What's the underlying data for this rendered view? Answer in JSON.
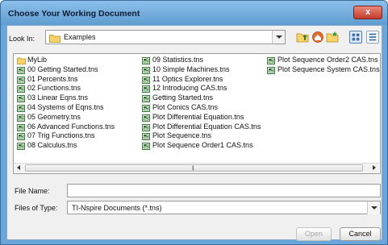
{
  "dialog": {
    "title": "Choose Your Working Document",
    "close_label": "x"
  },
  "look_in": {
    "label": "Look In:",
    "value": "Examples"
  },
  "toolbar": {
    "icons": [
      "up-folder-icon",
      "home-icon",
      "new-folder-icon",
      "list-view-icon",
      "details-view-icon"
    ]
  },
  "files": {
    "column1": [
      {
        "name": "MyLib",
        "type": "folder"
      },
      {
        "name": "00 Getting Started.tns",
        "type": "doc"
      },
      {
        "name": "01 Percents.tns",
        "type": "doc"
      },
      {
        "name": "02 Functions.tns",
        "type": "doc"
      },
      {
        "name": "03 Linear Eqns.tns",
        "type": "doc"
      },
      {
        "name": "04 Systems of Eqns.tns",
        "type": "doc"
      },
      {
        "name": "05 Geometry.tns",
        "type": "doc"
      },
      {
        "name": "06 Advanced Functions.tns",
        "type": "doc"
      },
      {
        "name": "07 Trig Functions.tns",
        "type": "doc"
      },
      {
        "name": "08 Calculus.tns",
        "type": "doc"
      }
    ],
    "column2": [
      {
        "name": "09 Statistics.tns",
        "type": "doc"
      },
      {
        "name": "10 Simple Machines.tns",
        "type": "doc"
      },
      {
        "name": "11 Optics Explorer.tns",
        "type": "doc"
      },
      {
        "name": "12 Introducing CAS.tns",
        "type": "doc"
      },
      {
        "name": "Getting Started.tns",
        "type": "doc"
      },
      {
        "name": "Plot Conics CAS.tns",
        "type": "doc"
      },
      {
        "name": "Plot Differential Equation.tns",
        "type": "doc"
      },
      {
        "name": "Plot Differential Equation CAS.tns",
        "type": "doc"
      },
      {
        "name": "Plot Sequence.tns",
        "type": "doc"
      },
      {
        "name": "Plot Sequence Order1 CAS.tns",
        "type": "doc"
      }
    ],
    "column3": [
      {
        "name": "Plot Sequence Order2 CAS.tns",
        "type": "doc"
      },
      {
        "name": "Plot Sequence System CAS.tns",
        "type": "doc"
      }
    ]
  },
  "file_name": {
    "label": "File Name:",
    "value": ""
  },
  "file_type": {
    "label": "Files of Type:",
    "value": "TI-Nspire Documents (*.tns)"
  },
  "buttons": {
    "open": "Open",
    "cancel": "Cancel"
  },
  "colors": {
    "titlebar": "#6aa6d9",
    "close": "#c43b2b",
    "folder": "#f2c94c",
    "doc_icon": "#2a6e2a"
  }
}
